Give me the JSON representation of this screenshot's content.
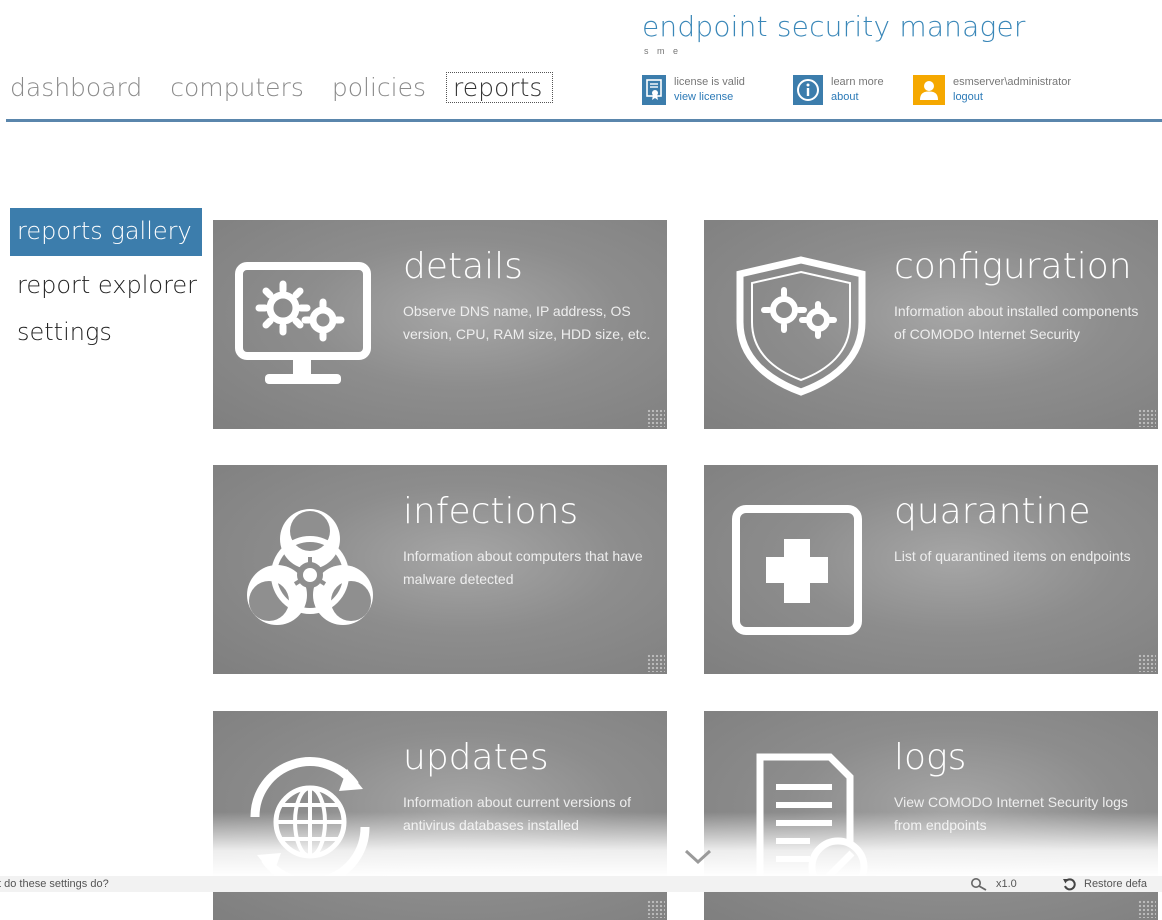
{
  "app": {
    "title": "endpoint security manager",
    "subtitle": "s m e"
  },
  "nav": {
    "items": [
      {
        "label": "dashboard"
      },
      {
        "label": "computers"
      },
      {
        "label": "policies"
      },
      {
        "label": "reports",
        "active": true
      }
    ]
  },
  "header": {
    "license": {
      "status": "license is valid",
      "link": "view license",
      "icon": "license-certificate-icon"
    },
    "about": {
      "status": "learn more",
      "link": "about",
      "icon": "info-icon"
    },
    "user": {
      "name": "esmserver\\administrator",
      "link": "logout",
      "icon": "user-icon"
    }
  },
  "sidebar": {
    "items": [
      {
        "label": "reports gallery",
        "active": true
      },
      {
        "label": "report explorer"
      },
      {
        "label": "settings"
      }
    ]
  },
  "tiles": [
    {
      "title": "details",
      "description": "Observe DNS name, IP address, OS version, CPU, RAM size, HDD size, etc.",
      "icon": "monitor-gears-icon"
    },
    {
      "title": "configuration",
      "description": "Information about installed components of COMODO Internet Security",
      "icon": "shield-gears-icon"
    },
    {
      "title": "infections",
      "description": "Information about computers that have malware detected",
      "icon": "biohazard-icon"
    },
    {
      "title": "quarantine",
      "description": "List of quarantined items on endpoints",
      "icon": "quarantine-cross-icon"
    },
    {
      "title": "updates",
      "description": "Information about current versions of antivirus databases installed",
      "icon": "globe-refresh-icon"
    },
    {
      "title": "logs",
      "description": "View COMODO Internet Security logs from endpoints",
      "icon": "log-document-icon"
    }
  ],
  "status": {
    "help": "t do these settings do?",
    "zoom": "x1.0",
    "restore": "Restore defa"
  },
  "colors": {
    "accent": "#3c7dac",
    "brand_text": "#3a87b8",
    "tile_bg": "#8d8d8d",
    "user_icon": "#f5a800",
    "license_icon": "#3c7dac"
  }
}
